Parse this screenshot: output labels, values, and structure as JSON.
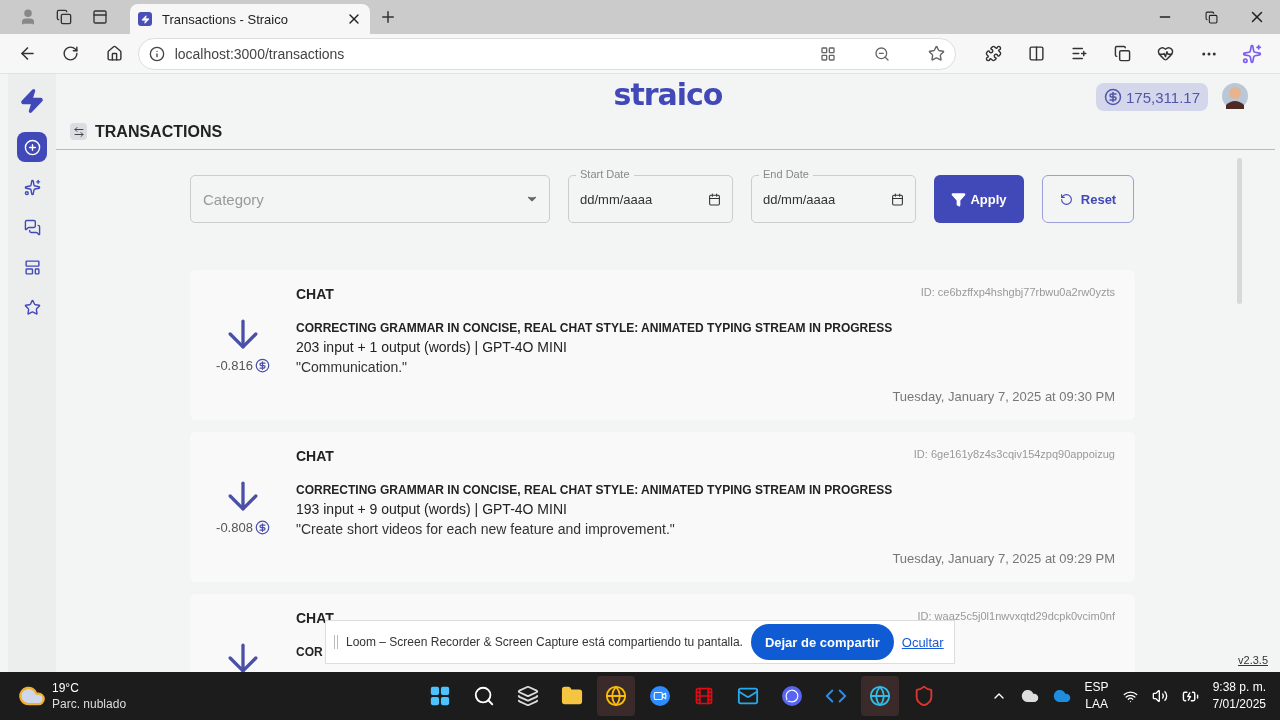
{
  "browser": {
    "tab": {
      "title": "Transactions - Straico",
      "selected": true
    },
    "url": "localhost:3000/transactions"
  },
  "sidebar": {
    "items": [
      {
        "selected": true
      },
      {
        "selected": false
      },
      {
        "selected": false
      },
      {
        "selected": false
      },
      {
        "selected": false
      }
    ]
  },
  "header": {
    "logo": "straico",
    "balance": "175,311.17"
  },
  "page_title": "TRANSACTIONS",
  "filters": {
    "category": {
      "placeholder": "Category"
    },
    "start_date": {
      "label": "Start Date",
      "value": "dd/mm/aaaa"
    },
    "end_date": {
      "label": "End Date",
      "value": "dd/mm/aaaa"
    },
    "apply": "Apply",
    "reset": "Reset"
  },
  "transactions": [
    {
      "type": "CHAT",
      "id": "ID: ce6bzffxp4hshgbj77rbwu0a2rw0yzts",
      "heading": "CORRECTING GRAMMAR IN CONCISE, REAL CHAT STYLE: ANIMATED TYPING STREAM IN PROGRESS",
      "usage": "203 input + 1 output (words) | GPT-4O MINI",
      "message": "\"Communication.\"",
      "date": "Tuesday, January 7, 2025 at 09:30 PM",
      "amount": "-0.816"
    },
    {
      "type": "CHAT",
      "id": "ID: 6ge161y8z4s3cqiv154zpq90appoizug",
      "heading": "CORRECTING GRAMMAR IN CONCISE, REAL CHAT STYLE: ANIMATED TYPING STREAM IN PROGRESS",
      "usage": "193 input + 9 output (words) | GPT-4O MINI",
      "message": "\"Create short videos for each new feature and improvement.\"",
      "date": "Tuesday, January 7, 2025 at 09:29 PM",
      "amount": "-0.808"
    },
    {
      "type": "CHAT",
      "id": "ID: waaz5c5j0l1nwvxqtd29dcpk0vcim0nf",
      "heading": "COR"
    }
  ],
  "version": "v2.3.5",
  "share_bar": {
    "message": "Loom – Screen Recorder & Screen Capture está compartiendo tu pantalla.",
    "stop": "Dejar de compartir",
    "hide": "Ocultar"
  },
  "taskbar": {
    "weather": {
      "temp": "19°C",
      "condition": "Parc. nublado"
    },
    "apps": [
      {
        "active": false
      },
      {
        "active": false
      },
      {
        "active": false
      },
      {
        "active": false
      },
      {
        "active": true
      },
      {
        "active": false
      },
      {
        "active": false
      },
      {
        "active": false
      },
      {
        "active": false
      },
      {
        "active": false
      },
      {
        "active": true
      },
      {
        "active": false
      }
    ],
    "language": "ESP",
    "layout": "LAA",
    "time": "9:38 p. m.",
    "date": "7/01/2025"
  }
}
